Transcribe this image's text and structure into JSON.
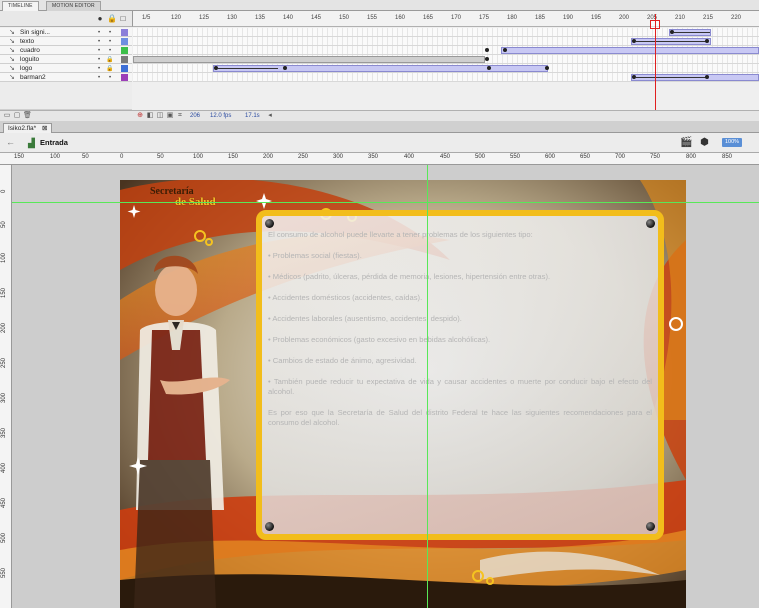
{
  "panel_tabs": [
    "TIMELINE",
    "MOTION EDITOR"
  ],
  "timeline": {
    "frame_numbers": [
      "1/5",
      "120",
      "125",
      "130",
      "135",
      "140",
      "145",
      "150",
      "155",
      "160",
      "165",
      "170",
      "175",
      "180",
      "185",
      "190",
      "195",
      "200",
      "205",
      "210",
      "215",
      "220"
    ],
    "layers": [
      {
        "name": "Sin signi...",
        "lock": "•",
        "color": "#8b7fd9"
      },
      {
        "name": "texto",
        "lock": "•",
        "color": "#6e8fe0"
      },
      {
        "name": "cuadro",
        "lock": "•",
        "color": "#3cbf4a"
      },
      {
        "name": "loguito",
        "lock": "🔒",
        "color": "#7a7a7a"
      },
      {
        "name": "logo",
        "lock": "🔒",
        "color": "#3d6fd6"
      },
      {
        "name": "barman2",
        "lock": "•",
        "color": "#9c3fb8"
      }
    ],
    "footer": {
      "frame": "206",
      "fps": "12.0 fps",
      "time": "17.1s"
    }
  },
  "document": {
    "tab_label": "Isiko2.fla*",
    "scene_label": "Entrada",
    "zoom_label": "100%"
  },
  "ruler": {
    "h_labels": [
      "150",
      "100",
      "50",
      "0",
      "50",
      "100",
      "150",
      "200",
      "250",
      "300",
      "350",
      "400",
      "450",
      "500",
      "550",
      "600",
      "650",
      "700",
      "750",
      "800",
      "850"
    ],
    "v_labels": [
      "0",
      "50",
      "100",
      "150",
      "200",
      "250",
      "300",
      "350",
      "400",
      "450",
      "500",
      "550"
    ]
  },
  "stage": {
    "logo_line1": "Secretaría",
    "logo_line2": "de Salud",
    "paragraphs": [
      "El consumo de alcohol puede llevarte a tener problemas de los siguientes tipo:",
      "•  Problemas social (fiestas).",
      "•  Médicos (padrito, úlceras, pérdida de memoria, lesiones, hipertensión entre otras).",
      "•  Accidentes domésticos (accidentes, caídas).",
      "•  Accidentes laborales (ausentismo, accidentes, despido).",
      "•  Problemas económicos (gasto excesivo en bebidas alcohólicas).",
      "•  Cambios de estado de ánimo, agresividad.",
      "•  También puede reducir tu expectativa de vida y causar accidentes o muerte por conducir bajo el efecto del alcohol.",
      "Es por eso que la Secretaría de Salud del distrito Federal te hace las siguientes recomendaciones para el consumo del alcohol."
    ]
  },
  "colors": {
    "accent": "#f2bd1b",
    "playhead": "#e02020",
    "guide": "#58e858",
    "tween": "#c8c8f4"
  }
}
